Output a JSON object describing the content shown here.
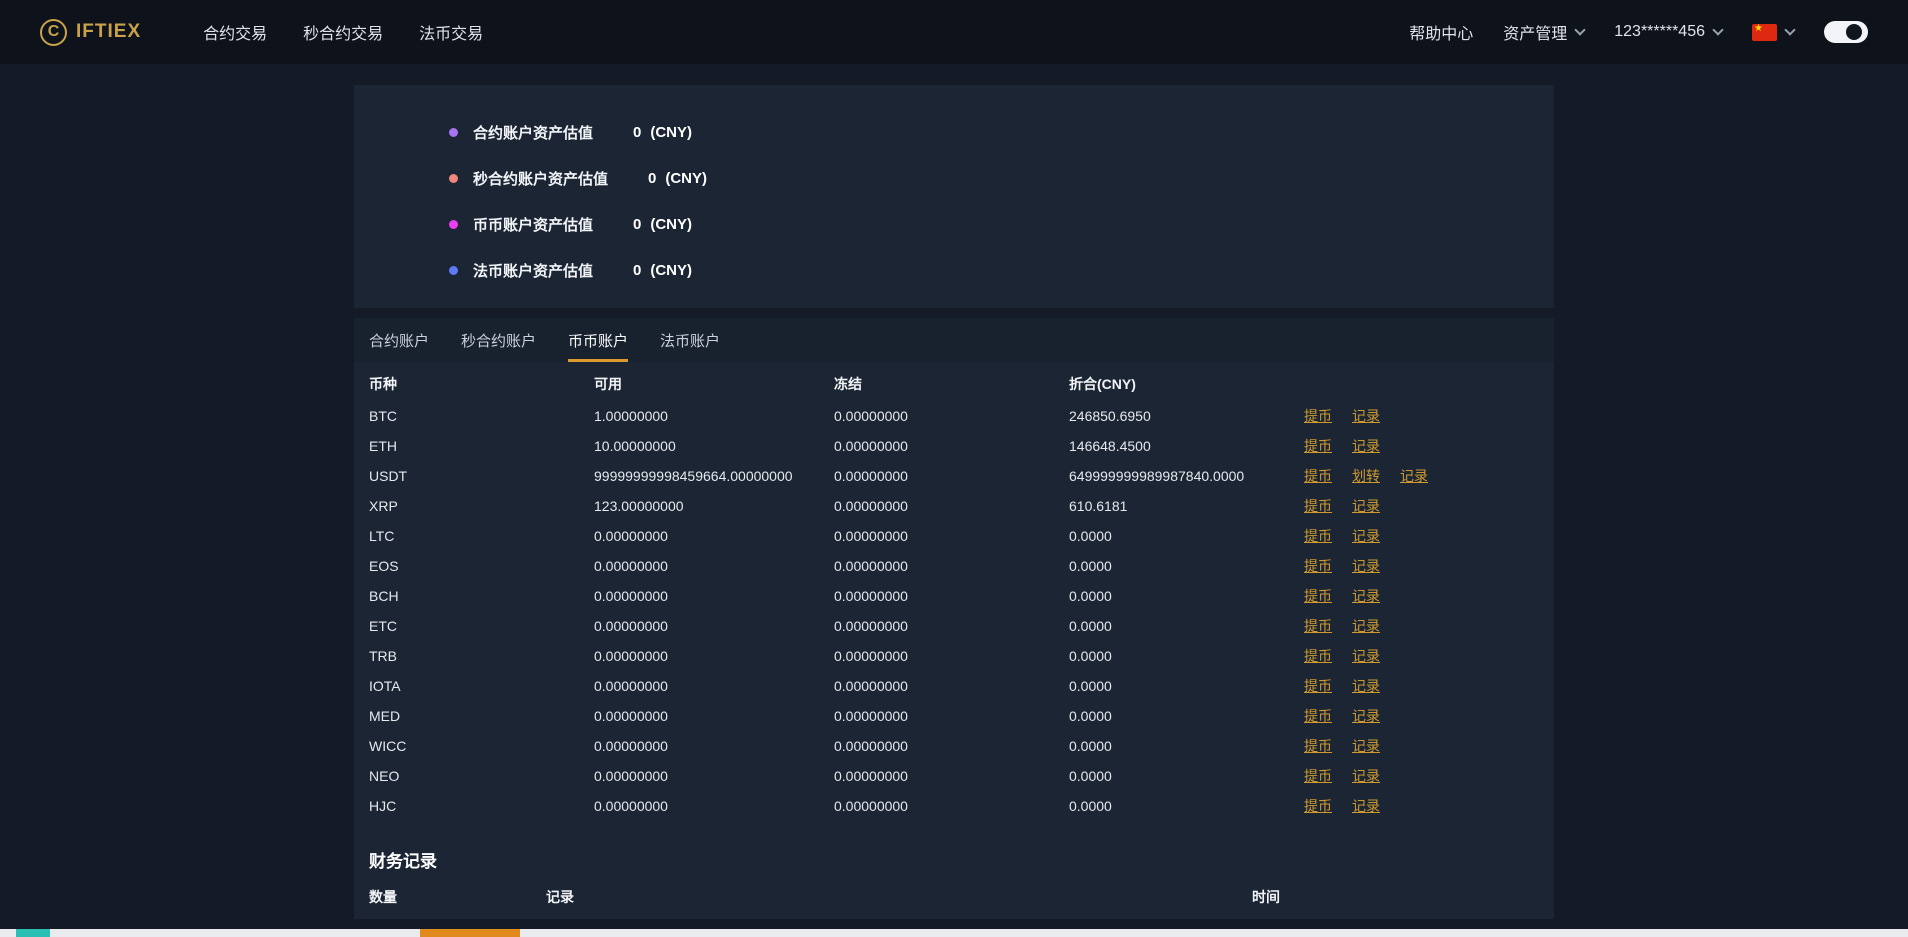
{
  "navbar": {
    "brand": "IFTIEX",
    "menu": [
      {
        "label": "合约交易",
        "name": "nav-contract-trading"
      },
      {
        "label": "秒合约交易",
        "name": "nav-second-contract-trading"
      },
      {
        "label": "法币交易",
        "name": "nav-fiat-trading"
      }
    ],
    "help": "帮助中心",
    "assets": "资产管理",
    "account": "123******456"
  },
  "summary": {
    "items": [
      {
        "label": "合约账户资产估值",
        "value": "0",
        "unit": "(CNY)",
        "dot_color": "#a775f1"
      },
      {
        "label": "秒合约账户资产估值",
        "value": "0",
        "unit": "(CNY)",
        "dot_color": "#f2867c"
      },
      {
        "label": "币币账户资产估值",
        "value": "0",
        "unit": "(CNY)",
        "dot_color": "#ee3ef2"
      },
      {
        "label": "法币账户资产估值",
        "value": "0",
        "unit": "(CNY)",
        "dot_color": "#5d7bf7"
      }
    ]
  },
  "tabs": [
    {
      "label": "合约账户",
      "name": "tab-contract-account",
      "active": false
    },
    {
      "label": "秒合约账户",
      "name": "tab-second-contract-account",
      "active": false
    },
    {
      "label": "币币账户",
      "name": "tab-coin-account",
      "active": true
    },
    {
      "label": "法币账户",
      "name": "tab-fiat-account",
      "active": false
    }
  ],
  "table": {
    "headers": [
      "币种",
      "可用",
      "冻结",
      "折合(CNY)"
    ],
    "action_labels": {
      "withdraw": "提币",
      "transfer": "划转",
      "record": "记录"
    },
    "rows": [
      {
        "coin": "BTC",
        "available": "1.00000000",
        "frozen": "0.00000000",
        "converted": "246850.6950",
        "actions": [
          "withdraw",
          "record"
        ]
      },
      {
        "coin": "ETH",
        "available": "10.00000000",
        "frozen": "0.00000000",
        "converted": "146648.4500",
        "actions": [
          "withdraw",
          "record"
        ]
      },
      {
        "coin": "USDT",
        "available": "99999999998459664.00000000",
        "frozen": "0.00000000",
        "converted": "649999999989987840.0000",
        "actions": [
          "withdraw",
          "transfer",
          "record"
        ]
      },
      {
        "coin": "XRP",
        "available": "123.00000000",
        "frozen": "0.00000000",
        "converted": "610.6181",
        "actions": [
          "withdraw",
          "record"
        ]
      },
      {
        "coin": "LTC",
        "available": "0.00000000",
        "frozen": "0.00000000",
        "converted": "0.0000",
        "actions": [
          "withdraw",
          "record"
        ]
      },
      {
        "coin": "EOS",
        "available": "0.00000000",
        "frozen": "0.00000000",
        "converted": "0.0000",
        "actions": [
          "withdraw",
          "record"
        ]
      },
      {
        "coin": "BCH",
        "available": "0.00000000",
        "frozen": "0.00000000",
        "converted": "0.0000",
        "actions": [
          "withdraw",
          "record"
        ]
      },
      {
        "coin": "ETC",
        "available": "0.00000000",
        "frozen": "0.00000000",
        "converted": "0.0000",
        "actions": [
          "withdraw",
          "record"
        ]
      },
      {
        "coin": "TRB",
        "available": "0.00000000",
        "frozen": "0.00000000",
        "converted": "0.0000",
        "actions": [
          "withdraw",
          "record"
        ]
      },
      {
        "coin": "IOTA",
        "available": "0.00000000",
        "frozen": "0.00000000",
        "converted": "0.0000",
        "actions": [
          "withdraw",
          "record"
        ]
      },
      {
        "coin": "MED",
        "available": "0.00000000",
        "frozen": "0.00000000",
        "converted": "0.0000",
        "actions": [
          "withdraw",
          "record"
        ]
      },
      {
        "coin": "WICC",
        "available": "0.00000000",
        "frozen": "0.00000000",
        "converted": "0.0000",
        "actions": [
          "withdraw",
          "record"
        ]
      },
      {
        "coin": "NEO",
        "available": "0.00000000",
        "frozen": "0.00000000",
        "converted": "0.0000",
        "actions": [
          "withdraw",
          "record"
        ]
      },
      {
        "coin": "HJC",
        "available": "0.00000000",
        "frozen": "0.00000000",
        "converted": "0.0000",
        "actions": [
          "withdraw",
          "record"
        ]
      }
    ]
  },
  "records": {
    "title": "财务记录",
    "headers": [
      "数量",
      "记录",
      "时间"
    ]
  },
  "colors": {
    "accent_link": "#d09a30",
    "tab_underline": "#dc9a2e",
    "brand_gold": "#c9a24a"
  }
}
